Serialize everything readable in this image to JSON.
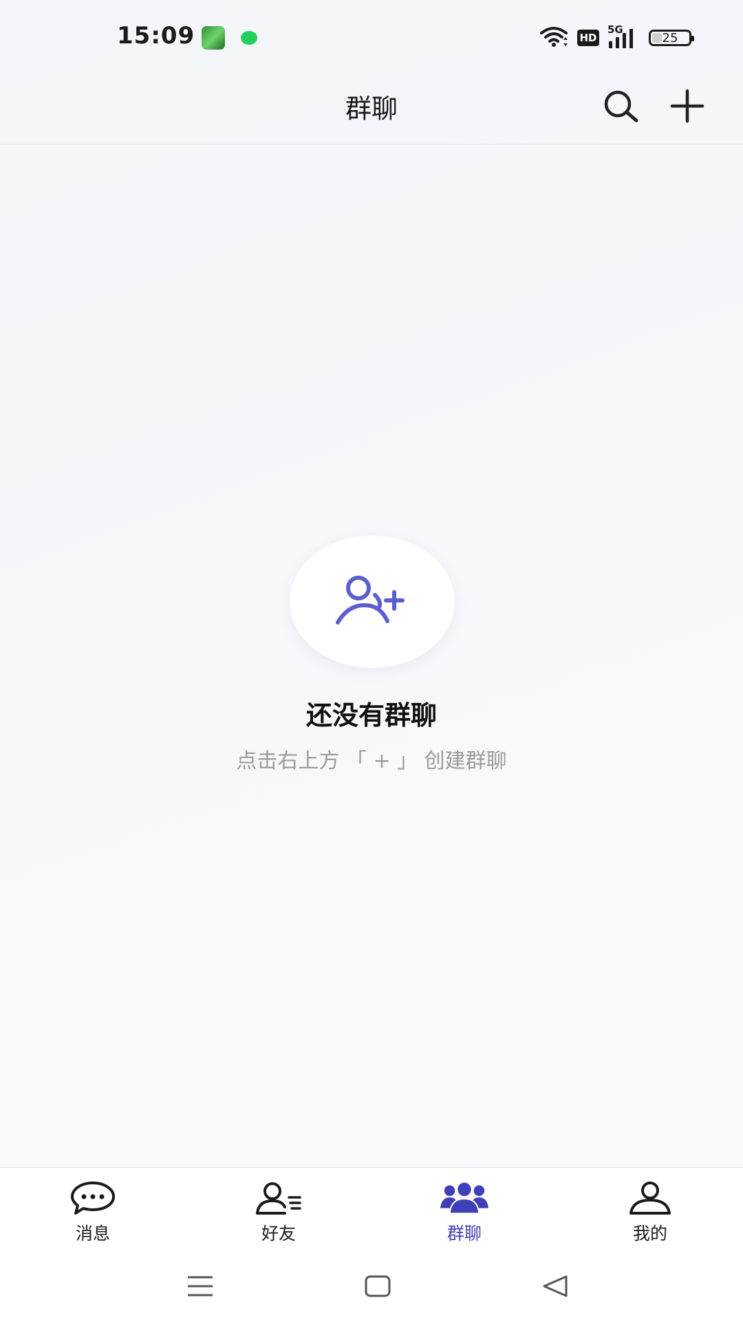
{
  "status_bar": {
    "time": "15:09",
    "network": "5G",
    "hd_label": "HD",
    "battery_level": "25"
  },
  "header": {
    "title": "群聊",
    "icons": [
      "search-icon",
      "plus-icon"
    ]
  },
  "empty_state": {
    "icon": "add-user-icon",
    "title": "还没有群聊",
    "hint": "点击右上方 「 + 」 创建群聊"
  },
  "tabs": [
    {
      "label": "消息",
      "icon": "chat-bubble-icon",
      "active": false
    },
    {
      "label": "好友",
      "icon": "friends-list-icon",
      "active": false
    },
    {
      "label": "群聊",
      "icon": "group-icon",
      "active": true
    },
    {
      "label": "我的",
      "icon": "profile-icon",
      "active": false
    }
  ],
  "system_nav": {
    "buttons": [
      "menu-icon",
      "home-icon",
      "back-icon"
    ]
  },
  "colors": {
    "accent": "#3f3fb8",
    "icon_accent": "#5a5fcf",
    "text_primary": "#111111",
    "text_secondary": "#9a9a9f",
    "status_green": "#1fcf5a"
  }
}
